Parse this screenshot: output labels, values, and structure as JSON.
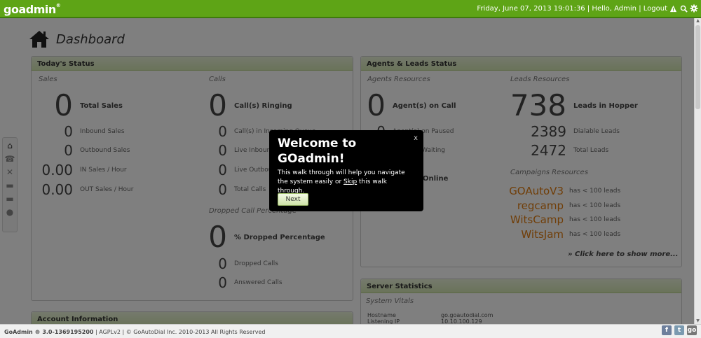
{
  "app": {
    "logo": "goadmin",
    "logo_reg": "®"
  },
  "topbar": {
    "datetime": "Friday, June 07, 2013 19:01:36",
    "greeting": "Hello, Admin",
    "logout": "Logout",
    "icons": [
      "warning-icon",
      "search-icon",
      "gear-icon"
    ]
  },
  "page": {
    "title": "Dashboard"
  },
  "sidebar": {
    "icons": [
      "home-icon",
      "phone-icon",
      "tools-icon",
      "folder-icon",
      "folder-icon",
      "chat-icon"
    ]
  },
  "today_status": {
    "title": "Today's Status",
    "sales": {
      "label": "Sales",
      "total": {
        "value": "0",
        "label": "Total Sales"
      },
      "rows": [
        {
          "value": "0",
          "label": "Inbound Sales"
        },
        {
          "value": "0",
          "label": "Outbound Sales"
        },
        {
          "value": "0.00",
          "label": "IN Sales / Hour"
        },
        {
          "value": "0.00",
          "label": "OUT Sales / Hour"
        }
      ]
    },
    "calls": {
      "label": "Calls",
      "total": {
        "value": "0",
        "label": "Call(s) Ringing"
      },
      "rows": [
        {
          "value": "0",
          "label": "Call(s) in Incoming Queue"
        },
        {
          "value": "0",
          "label": "Live Inbound"
        },
        {
          "value": "0",
          "label": "Live Outbound"
        },
        {
          "value": "0",
          "label": "Total Calls"
        }
      ]
    },
    "dropped": {
      "label": "Dropped Call Percentage",
      "total": {
        "value": "0",
        "label": "% Dropped Percentage"
      },
      "rows": [
        {
          "value": "0",
          "label": "Dropped Calls"
        },
        {
          "value": "0",
          "label": "Answered Calls"
        }
      ]
    }
  },
  "account_info": {
    "title": "Account Information"
  },
  "agents_leads": {
    "title": "Agents & Leads Status",
    "agents": {
      "label": "Agents Resources",
      "total": {
        "value": "0",
        "label": "Agent(s) on Call"
      },
      "rows": [
        {
          "value": "0",
          "label": "Agent(s) on Paused"
        },
        {
          "value": "0",
          "label": "Agent(s) Waiting"
        }
      ],
      "online": {
        "value": "0",
        "label": "Agents Online"
      }
    },
    "leads": {
      "label": "Leads Resources",
      "total": {
        "value": "738",
        "label": "Leads in Hopper"
      },
      "rows": [
        {
          "value": "2389",
          "label": "Dialable Leads"
        },
        {
          "value": "2472",
          "label": "Total Leads"
        }
      ]
    },
    "campaigns": {
      "label": "Campaigns Resources",
      "items": [
        {
          "name": "GOAutoV3",
          "text": "has < 100 leads"
        },
        {
          "name": "regcamp",
          "text": "has < 100 leads"
        },
        {
          "name": "WitsCamp",
          "text": "has < 100 leads"
        },
        {
          "name": "WitsJam",
          "text": "has < 100 leads"
        }
      ],
      "more": "» Click here to show more..."
    }
  },
  "server_stats": {
    "title": "Server Statistics",
    "vitals_label": "System Vitals",
    "rows": [
      {
        "key": "Hostname",
        "value": "go.goautodial.com"
      },
      {
        "key": "Listening IP",
        "value": "10.10.100.129"
      }
    ]
  },
  "footer": {
    "version": "GoAdmin ® 3.0-1369195200",
    "license": "| AGPLv2 | © GoAutoDial Inc. 2010-2013 All Rights Reserved",
    "icons": [
      "facebook-icon",
      "twitter-icon",
      "goadmin-icon"
    ]
  },
  "walkthrough": {
    "title": "Welcome to GOadmin!",
    "desc_pre": "This walk through will help you navigate the system easily or ",
    "skip": "Skip",
    "desc_post": " this walk through.",
    "close": "x",
    "next": "Next"
  }
}
